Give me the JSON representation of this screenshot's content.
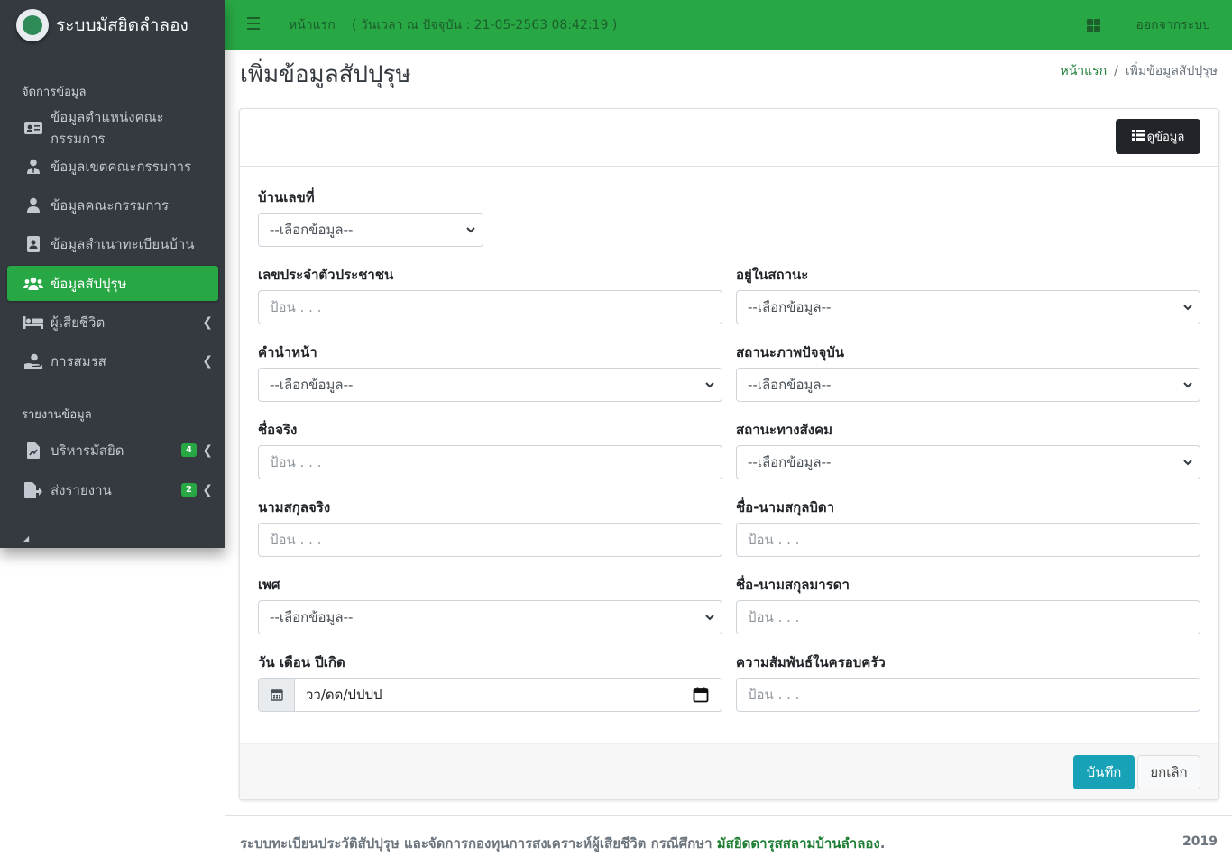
{
  "app": {
    "title": "ระบบมัสยิดลำลอง"
  },
  "topbar": {
    "home_label": "หน้าแรก",
    "clock_text": "( วันเวลา ณ ปัจจุบัน : 21-05-2563 08:42:19 )",
    "logout_label": "ออกจากระบบ"
  },
  "sidebar": {
    "section_manage": "จัดการข้อมูล",
    "section_report": "รายงานข้อมูล",
    "items": [
      {
        "label": "ข้อมูลตำแหน่งคณะกรรมการ",
        "icon": "id-card-icon"
      },
      {
        "label": "ข้อมูลเขตคณะกรรมการ",
        "icon": "user-tie-icon"
      },
      {
        "label": "ข้อมูลคณะกรรมการ",
        "icon": "user-icon"
      },
      {
        "label": "ข้อมูลสำเนาทะเบียนบ้าน",
        "icon": "address-book-icon"
      },
      {
        "label": "ข้อมูลสัปปุรุษ",
        "icon": "users-icon"
      },
      {
        "label": "ผู้เสียชีวิต",
        "icon": "bed-icon"
      },
      {
        "label": "การสมรส",
        "icon": "hand-holding-heart-icon"
      },
      {
        "label": "บริหารมัสยิด",
        "icon": "file-chart-icon",
        "badge": "4"
      },
      {
        "label": "ส่งรายงาน",
        "icon": "file-export-icon",
        "badge": "2"
      }
    ]
  },
  "page": {
    "title": "เพิ่มข้อมูลสัปปุรุษ",
    "breadcrumb_home": "หน้าแรก",
    "breadcrumb_current": "เพิ่มข้อมูลสัปปุรุษ"
  },
  "card": {
    "view_button": "ดูข้อมูล",
    "save_button": "บันทึก",
    "cancel_button": "ยกเลิก"
  },
  "form": {
    "house_no": {
      "label": "บ้านเลขที่",
      "value": "--เลือกข้อมูล--"
    },
    "citizen_id": {
      "label": "เลขประจำตัวประชาชน",
      "placeholder": "ป้อน . . ."
    },
    "residence_status": {
      "label": "อยู่ในสถานะ",
      "value": "--เลือกข้อมูล--"
    },
    "prefix": {
      "label": "คำนำหน้า",
      "value": "--เลือกข้อมูล--"
    },
    "current_status": {
      "label": "สถานะภาพปัจจุบัน",
      "value": "--เลือกข้อมูล--"
    },
    "first_name": {
      "label": "ชื่อจริง",
      "placeholder": "ป้อน . . ."
    },
    "social_status": {
      "label": "สถานะทางสังคม",
      "value": "--เลือกข้อมูล--"
    },
    "last_name": {
      "label": "นามสกุลจริง",
      "placeholder": "ป้อน . . ."
    },
    "father_name": {
      "label": "ชื่อ-นามสกุลบิดา",
      "placeholder": "ป้อน . . ."
    },
    "gender": {
      "label": "เพศ",
      "value": "--เลือกข้อมูล--"
    },
    "mother_name": {
      "label": "ชื่อ-นามสกุลมารดา",
      "placeholder": "ป้อน . . ."
    },
    "birth_date": {
      "label": "วัน เดือน ปีเกิด",
      "value": "วว/ดด/ปปปป"
    },
    "family_relation": {
      "label": "ความสัมพันธ์ในครอบครัว",
      "placeholder": "ป้อน . . ."
    }
  },
  "footer": {
    "text": "ระบบทะเบียนประวัติสัปปุรุษ และจัดการกองทุนการสงเคราะห์ผู้เสียชีวิต กรณีศึกษา",
    "link": "มัสยิดดารุสสลามบ้านลำลอง",
    "period": ".",
    "year": "2019"
  },
  "colors": {
    "brand_green": "#28a745",
    "sidebar_dark": "#343a40",
    "save_teal": "#17a2b8"
  }
}
